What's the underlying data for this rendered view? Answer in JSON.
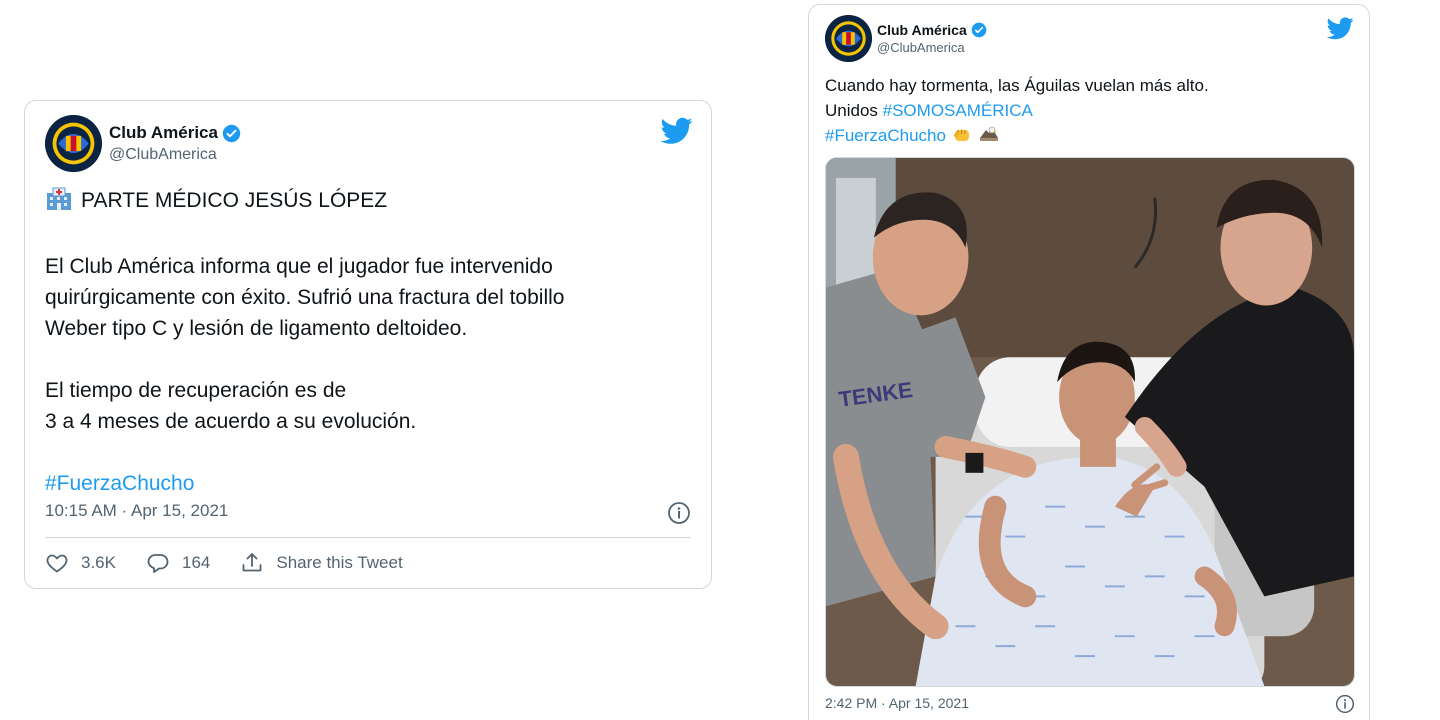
{
  "tweet1": {
    "display_name": "Club América",
    "handle": "@ClubAmerica",
    "lines": [
      "PARTE MÉDICO JESÚS LÓPEZ",
      "El Club América informa que el jugador fue intervenido",
      "quirúrgicamente con éxito. Sufrió una fractura del tobillo",
      "Weber tipo C y lesión de ligamento deltoideo.",
      "El tiempo de recuperación es de",
      "3 a 4 meses de acuerdo a su evolución."
    ],
    "hashtag": "#FuerzaChucho",
    "timestamp": "10:15 AM · Apr 15, 2021",
    "likes": "3.6K",
    "replies": "164",
    "share_label": "Share this Tweet"
  },
  "tweet2": {
    "display_name": "Club América",
    "handle": "@ClubAmerica",
    "line1": "Cuando hay tormenta, las Águilas vuelan más alto.",
    "line2_prefix": "Unidos ",
    "hashtag_1": "#SOMOSAMÉRICA",
    "hashtag_2": "#FuerzaChucho",
    "timestamp": "2:42 PM · Apr 15, 2021"
  },
  "icons": {
    "verified": "verified-badge-icon",
    "twitter": "twitter-bird-icon",
    "info": "info-icon",
    "like": "heart-icon",
    "reply": "reply-icon",
    "share": "share-icon",
    "hospital": "hospital-emoji",
    "fist": "fist-emoji",
    "eagle": "eagle-emoji"
  },
  "colors": {
    "link": "#1d9bf0",
    "text": "#0f1419",
    "secondary": "#536471",
    "border": "#cfd9de",
    "brand_navy": "#0c2444"
  }
}
